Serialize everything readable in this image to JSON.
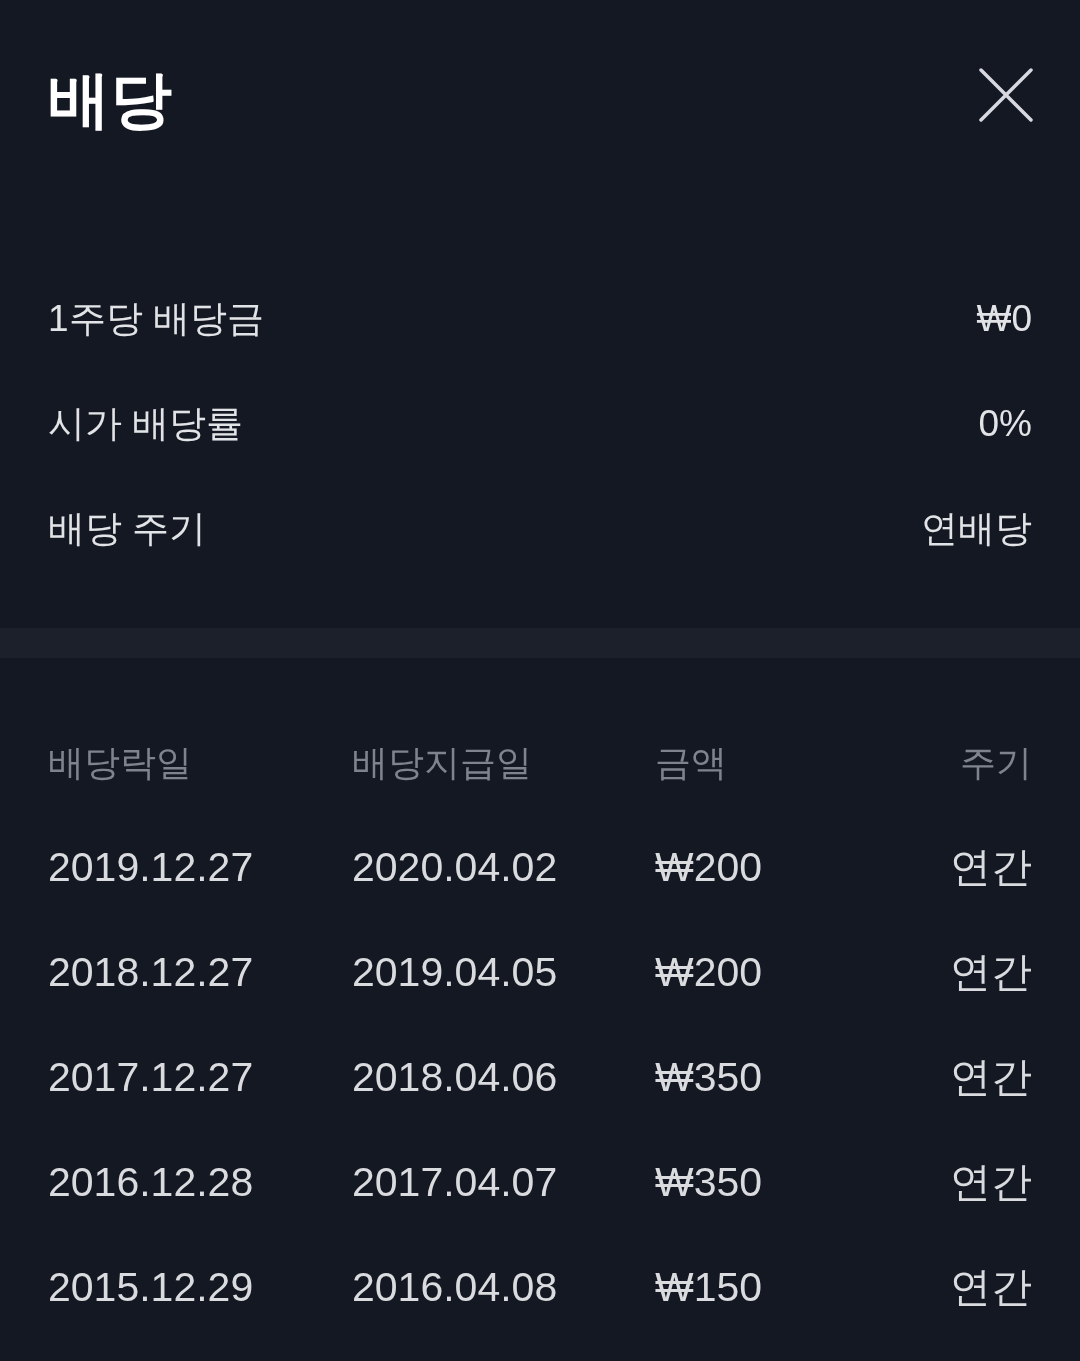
{
  "header": {
    "title": "배당"
  },
  "summary": [
    {
      "label": "1주당 배당금",
      "value": "₩0"
    },
    {
      "label": "시가 배당률",
      "value": "0%"
    },
    {
      "label": "배당 주기",
      "value": "연배당"
    }
  ],
  "table": {
    "columns": [
      "배당락일",
      "배당지급일",
      "금액",
      "주기"
    ],
    "rows": [
      [
        "2019.12.27",
        "2020.04.02",
        "₩200",
        "연간"
      ],
      [
        "2018.12.27",
        "2019.04.05",
        "₩200",
        "연간"
      ],
      [
        "2017.12.27",
        "2018.04.06",
        "₩350",
        "연간"
      ],
      [
        "2016.12.28",
        "2017.04.07",
        "₩350",
        "연간"
      ],
      [
        "2015.12.29",
        "2016.04.08",
        "₩150",
        "연간"
      ]
    ]
  }
}
